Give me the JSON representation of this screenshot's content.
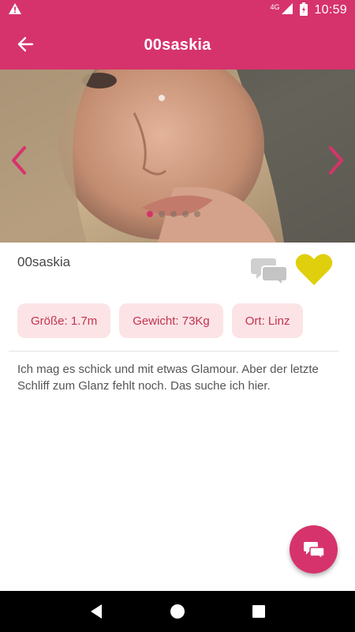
{
  "status_bar": {
    "network": "4G",
    "time": "10:59",
    "icons": [
      "warning-icon",
      "signal-icon",
      "battery-icon"
    ]
  },
  "app_bar": {
    "title": "00saskia",
    "back_icon": "arrow-left-icon"
  },
  "photo": {
    "page_count": 5,
    "active_page": 1,
    "prev_icon": "chevron-left-icon",
    "next_icon": "chevron-right-icon"
  },
  "profile": {
    "username": "00saskia",
    "chat_icon": "chat-bubbles-icon",
    "favorite_icon": "heart-icon",
    "chips": [
      {
        "label": "Größe: 1.7m"
      },
      {
        "label": "Gewicht: 73Kg"
      },
      {
        "label": "Ort: Linz"
      }
    ],
    "description": "Ich mag es schick und mit etwas Glamour. Aber der letzte Schliff zum Glanz fehlt noch. Das suche ich hier."
  },
  "fab": {
    "icon": "chat-icon"
  },
  "navigation": {
    "icons": [
      "back-triangle-icon",
      "home-circle-icon",
      "recents-square-icon"
    ]
  },
  "colors": {
    "primary": "#d6336c",
    "chip_bg": "#fbe3e6",
    "chip_text": "#c2334f",
    "heart": "#e0cf0c",
    "chat_grey": "#cfcfcf"
  }
}
